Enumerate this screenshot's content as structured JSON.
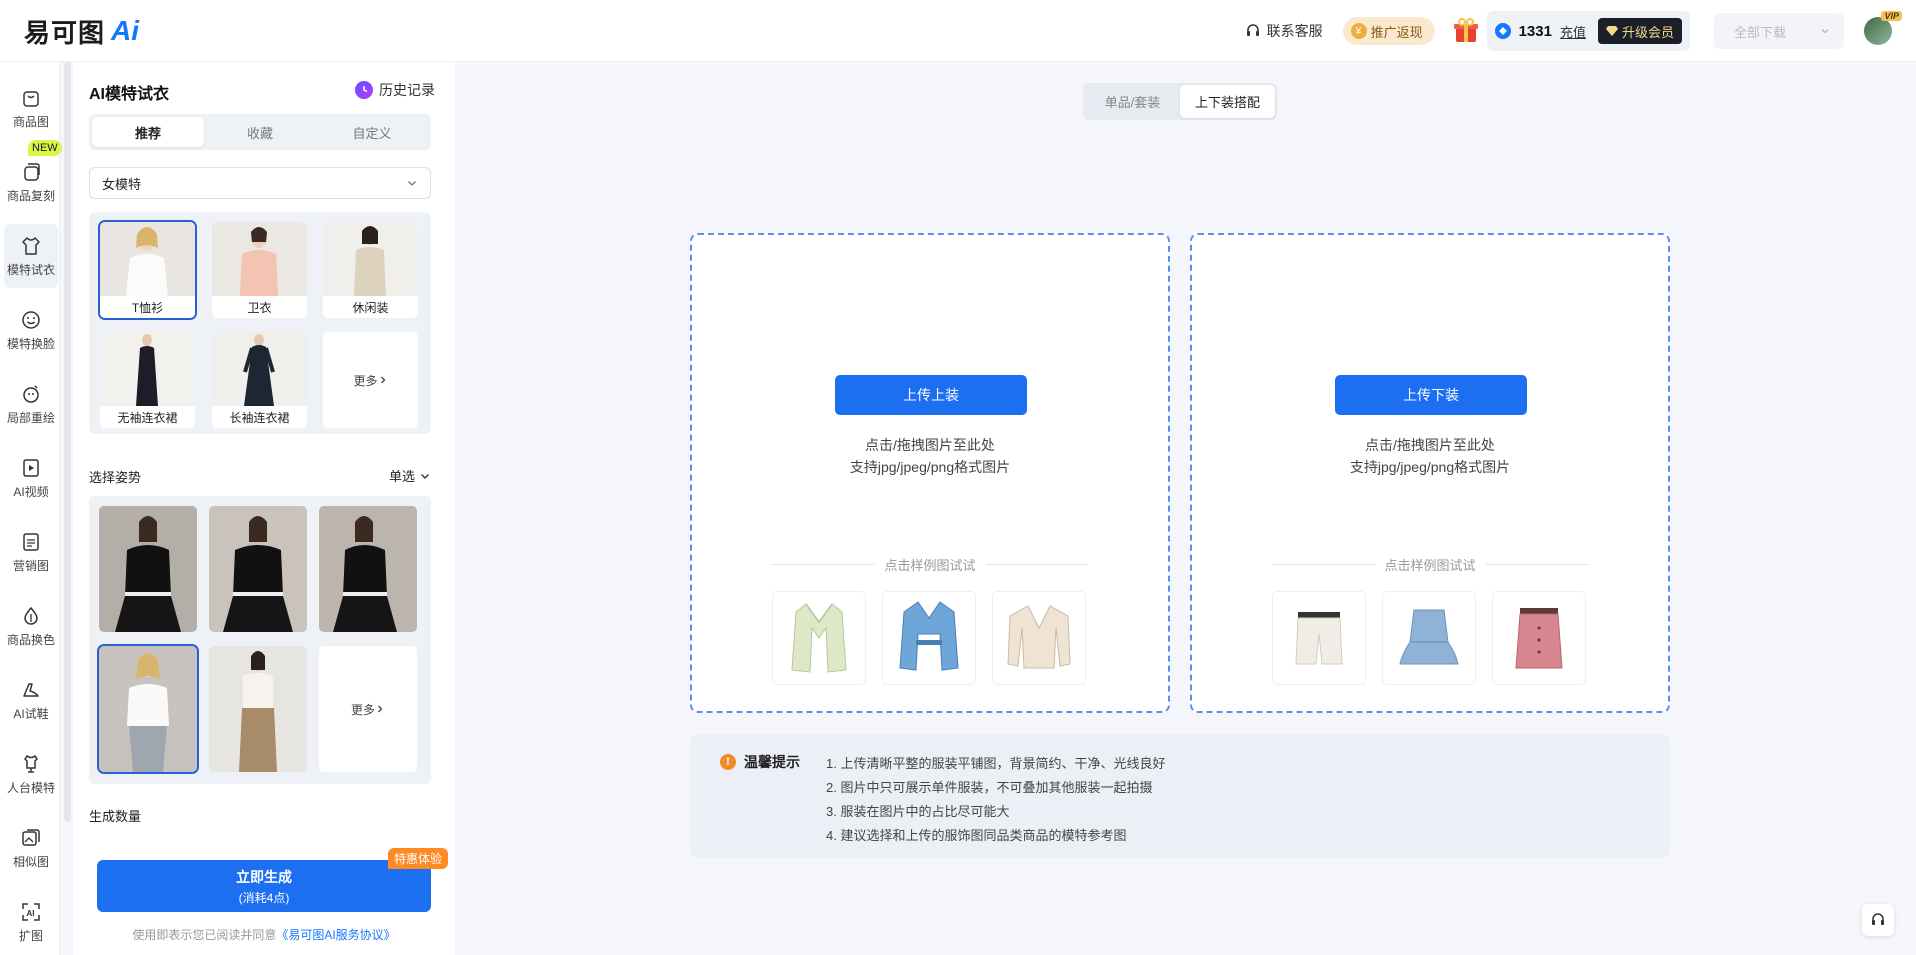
{
  "header": {
    "logo_text": "易可图",
    "logo_ai": "Ai",
    "service_label": "联系客服",
    "promo_label": "推广返现",
    "credits": "1331",
    "recharge_label": "充值",
    "vip_label": "升级会员",
    "download_label": "全部下载",
    "vip_tag": "VIP"
  },
  "sidenav": {
    "new_badge": "NEW",
    "items": [
      {
        "label": "商品图",
        "icon": "bag-icon"
      },
      {
        "label": "商品复刻",
        "icon": "copy-bag-icon"
      },
      {
        "label": "模特试衣",
        "icon": "shirt-icon"
      },
      {
        "label": "模特换脸",
        "icon": "face-icon"
      },
      {
        "label": "局部重绘",
        "icon": "repaint-icon"
      },
      {
        "label": "AI视频",
        "icon": "video-icon"
      },
      {
        "label": "营销图",
        "icon": "poster-icon"
      },
      {
        "label": "商品换色",
        "icon": "color-drop-icon"
      },
      {
        "label": "AI试鞋",
        "icon": "shoe-icon"
      },
      {
        "label": "人台模特",
        "icon": "mannequin-icon"
      },
      {
        "label": "相似图",
        "icon": "similar-image-icon"
      },
      {
        "label": "扩图",
        "icon": "expand-image-icon"
      }
    ],
    "expand_icon_text": "AI"
  },
  "panel": {
    "title": "AI模特试衣",
    "history_label": "历史记录",
    "tabs": [
      "推荐",
      "收藏",
      "自定义"
    ],
    "gender_select": "女模特",
    "models": [
      {
        "label": "T恤衫"
      },
      {
        "label": "卫衣"
      },
      {
        "label": "休闲装"
      },
      {
        "label": "无袖连衣裙"
      },
      {
        "label": "长袖连衣裙"
      }
    ],
    "more_label": "更多",
    "pose_section": "选择姿势",
    "single_select": "单选",
    "pose_more_label": "更多",
    "count_section": "生成数量",
    "generate_label": "立即生成",
    "generate_cost": "(消耗4点)",
    "special_tag": "特惠体验",
    "agreement_prefix": "使用即表示您已阅读并同意",
    "agreement_link": "《易可图AI服务协议》"
  },
  "main": {
    "tabs": [
      "单品/套装",
      "上下装搭配"
    ],
    "top_card": {
      "button": "上传上装",
      "hint1": "点击/拖拽图片至此处",
      "hint2": "支持jpg/jpeg/png格式图片",
      "try_label": "点击样例图试试"
    },
    "bottom_card": {
      "button": "上传下装",
      "hint1": "点击/拖拽图片至此处",
      "hint2": "支持jpg/jpeg/png格式图片",
      "try_label": "点击样例图试试"
    },
    "tips": {
      "title": "温馨提示",
      "items": [
        "1. 上传清晰平整的服装平铺图，背景简约、干净、光线良好",
        "2. 图片中只可展示单件服装，不可叠加其他服装一起拍摄",
        "3. 服装在图片中的占比尽可能大",
        "4. 建议选择和上传的服饰图同品类商品的模特参考图"
      ]
    }
  },
  "colors": {
    "primary": "#1d6ff2",
    "selected_border": "#2a5fd6",
    "promo_bg": "#fbe9cf",
    "vip_bg": "#1b1f27",
    "new_badge": "#d8f548",
    "special_tag": "#ff8a24"
  }
}
